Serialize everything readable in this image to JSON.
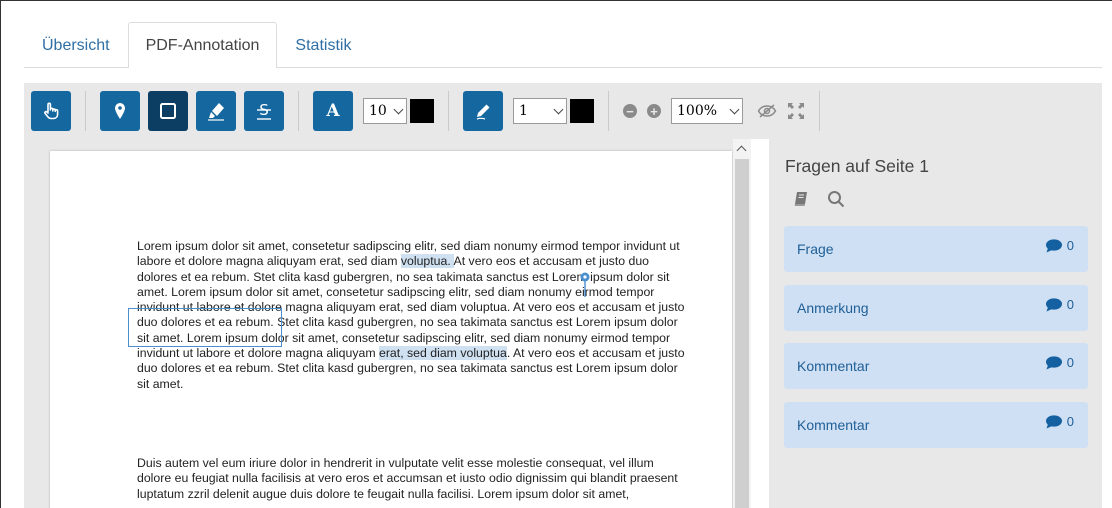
{
  "tabs": [
    {
      "label": "Übersicht"
    },
    {
      "label": "PDF-Annotation"
    },
    {
      "label": "Statistik"
    }
  ],
  "toolbar": {
    "font_size": "10",
    "line_width": "1",
    "zoom": "100%",
    "text_tool_letter": "A",
    "color_primary": "#14679f",
    "color_active": "#0c3e63"
  },
  "document": {
    "paragraph1": [
      "Lorem ipsum dolor sit amet, consetetur sadipscing elitr, sed diam nonumy eirmod tempor invidunt ut",
      "labore et dolore magna aliquyam erat, sed diam ",
      "voluptua. ",
      "At vero eos et accusam et justo duo",
      "dolores et ea rebum. Stet clita kasd gubergren, no sea takimata sanctus est Lorem ipsum dolor sit",
      "amet. Lorem ipsum dolor sit amet, consetetur sadipscing elitr, sed diam nonumy eirmod tempor",
      "invidunt ut labore et dolore magna aliquyam erat, sed diam voluptua. At vero eos et accusam et justo",
      "duo dolores et ea rebum. Stet clita kasd gubergren, no sea takimata sanctus est Lorem ipsum dolor",
      "sit amet. Lorem ipsum dolor sit amet, consetetur sadipscing elitr, sed diam nonumy eirmod tempor",
      "invidunt ut labore et dolore magna aliquyam ",
      "erat, sed diam voluptua",
      ". At vero eos et accusam et justo",
      "duo dolores et ea rebum. Stet clita kasd gubergren, no sea takimata sanctus est Lorem ipsum dolor",
      "sit amet."
    ],
    "paragraph2": [
      "Duis autem vel eum iriure dolor in hendrerit in vulputate velit esse molestie consequat, vel illum",
      "dolore eu feugiat nulla facilisis at vero eros et accumsan et iusto odio dignissim qui blandit praesent",
      "luptatum zzril delenit augue duis dolore te feugait nulla facilisi. Lorem ipsum dolor sit amet,"
    ]
  },
  "panel": {
    "title": "Fragen auf Seite 1",
    "questions": [
      {
        "label": "Frage",
        "count": "0"
      },
      {
        "label": "Anmerkung",
        "count": "0"
      },
      {
        "label": "Kommentar",
        "count": "0"
      },
      {
        "label": "Kommentar",
        "count": "0"
      }
    ]
  }
}
